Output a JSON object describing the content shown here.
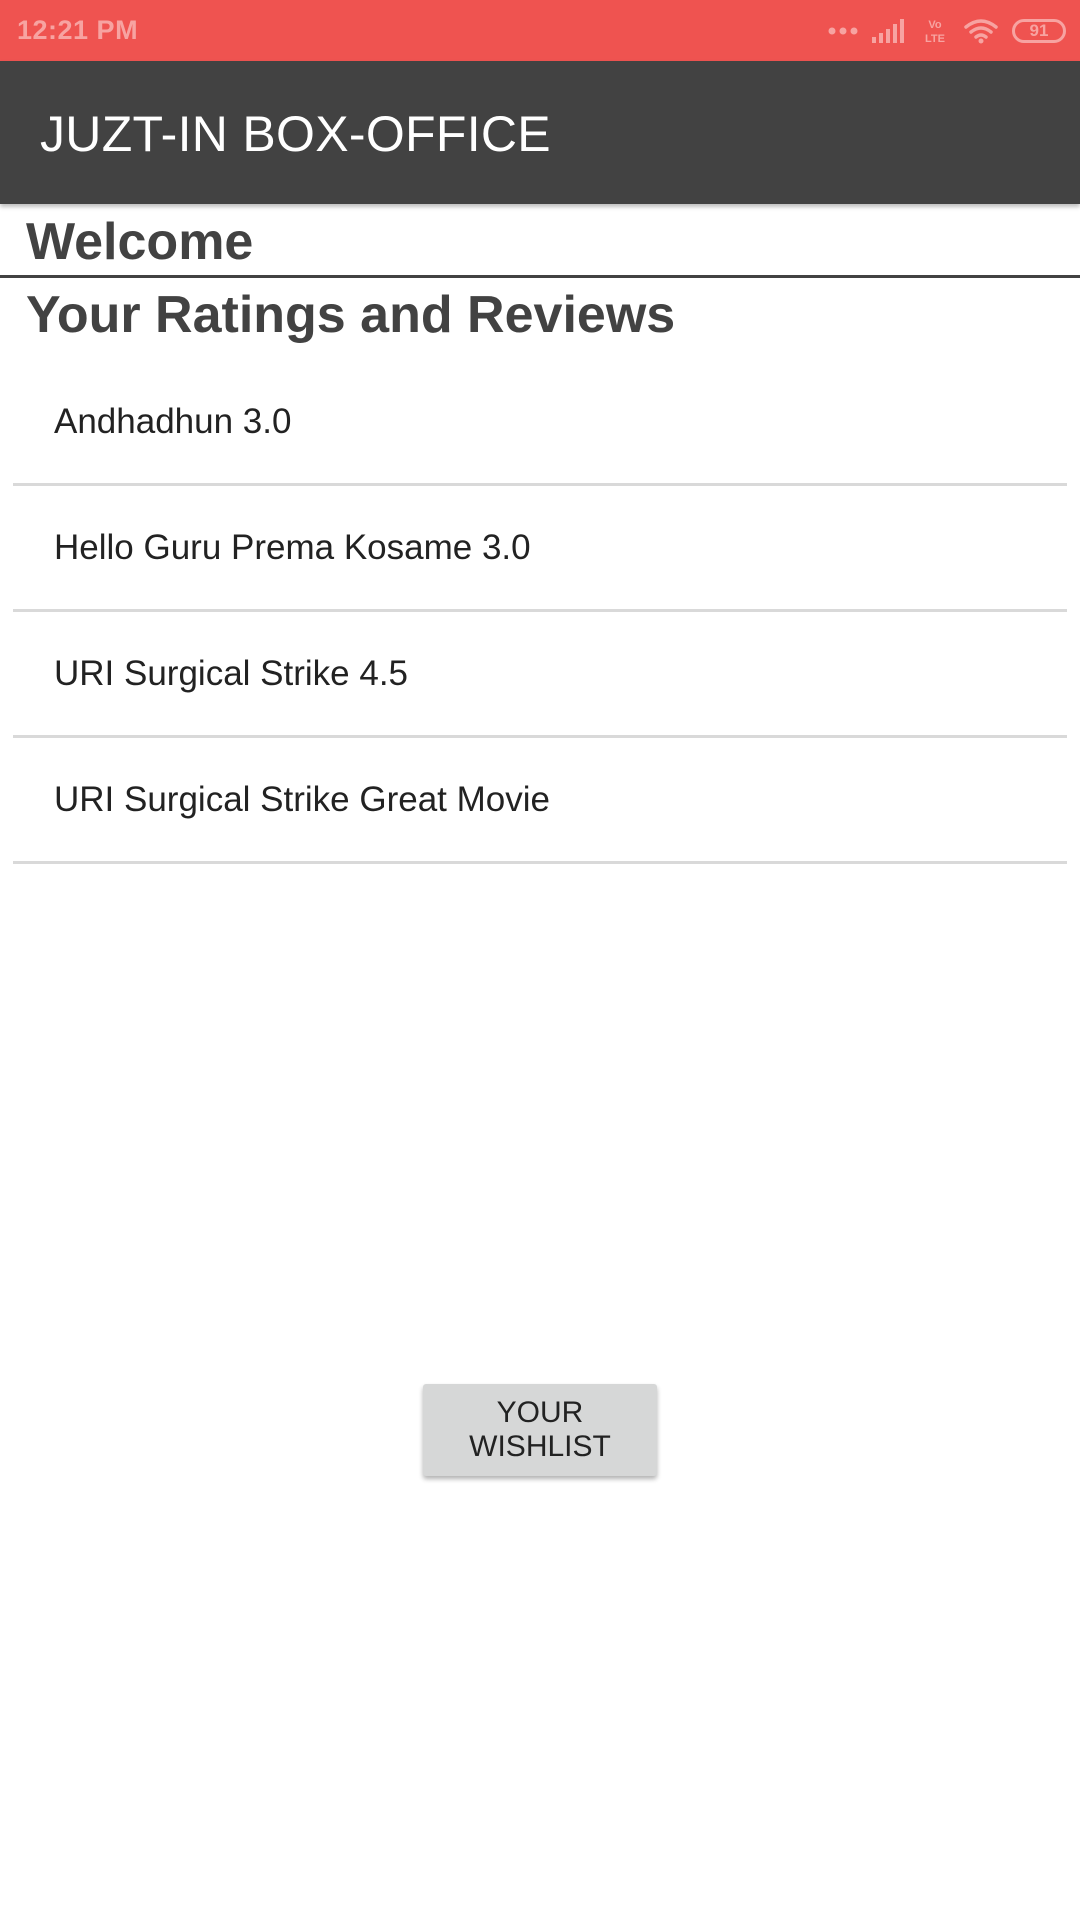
{
  "status_bar": {
    "time": "12:21 PM",
    "battery_level": "91",
    "network_label": "Vo LTE",
    "icons": [
      "more-dots-icon",
      "signal-bars-icon",
      "volte-icon",
      "wifi-icon",
      "battery-icon"
    ],
    "background_color": "#ef5350"
  },
  "app_bar": {
    "title": "JUZT-IN BOX-OFFICE",
    "background_color": "#424242"
  },
  "main": {
    "welcome": "Welcome",
    "section_title": "Your Ratings and Reviews",
    "reviews": [
      {
        "text": "Andhadhun 3.0"
      },
      {
        "text": "Hello Guru Prema Kosame 3.0"
      },
      {
        "text": "URI Surgical Strike 4.5"
      },
      {
        "text": "URI Surgical Strike Great Movie"
      }
    ],
    "wishlist_button": "YOUR WISHLIST"
  }
}
